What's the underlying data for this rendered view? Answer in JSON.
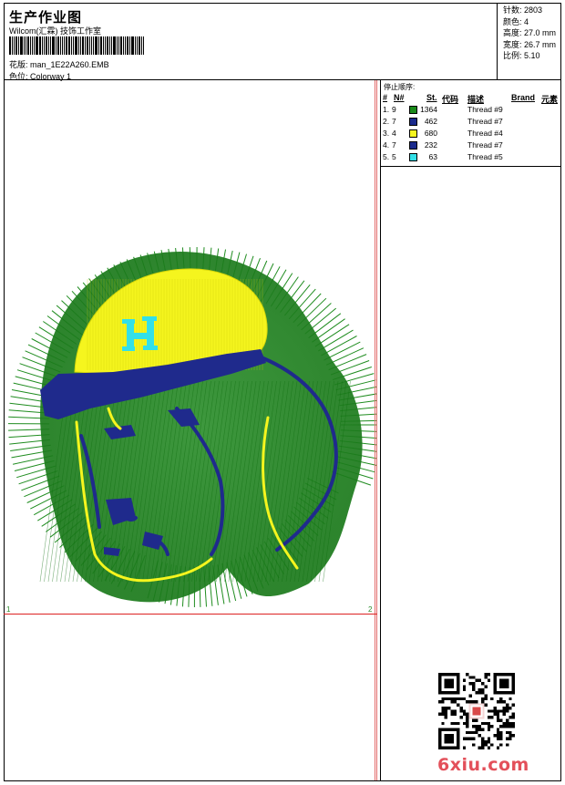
{
  "header": {
    "title": "生产作业图",
    "company": "Wilcom(汇霖) 技饰工作室",
    "design_label": "花版:",
    "design_file": "man_1E22A260.EMB",
    "colorway_label": "色位:",
    "colorway": "Colorway 1"
  },
  "specs": [
    {
      "label": "针数:",
      "value": "2803"
    },
    {
      "label": "颜色:",
      "value": "4"
    },
    {
      "label": "高度:",
      "value": "27.0 mm"
    },
    {
      "label": "宽度:",
      "value": "26.7 mm"
    },
    {
      "label": "比例:",
      "value": "5.10"
    }
  ],
  "stop_sequence": {
    "title": "停止顺序:",
    "headers": {
      "index": "#",
      "num": "N#",
      "stitches": "St.",
      "code": "代码",
      "desc": "描述",
      "brand": "Brand",
      "element": "元素"
    },
    "rows": [
      {
        "index": "1.",
        "num": "9",
        "color": "#1a8a1a",
        "stitches": "1364",
        "desc": "Thread #9"
      },
      {
        "index": "2.",
        "num": "7",
        "color": "#1a2a8c",
        "stitches": "462",
        "desc": "Thread #7"
      },
      {
        "index": "3.",
        "num": "4",
        "color": "#f5f51e",
        "stitches": "680",
        "desc": "Thread #4"
      },
      {
        "index": "4.",
        "num": "7",
        "color": "#1a2a8c",
        "stitches": "232",
        "desc": "Thread #7"
      },
      {
        "index": "5.",
        "num": "5",
        "color": "#33e0e8",
        "stitches": "63",
        "desc": "Thread #5"
      }
    ]
  },
  "canvas": {
    "marker_left": "1",
    "marker_right": "2"
  },
  "watermark": "6xiu.com",
  "colors": {
    "green": "#1f8c1f",
    "navy": "#1f2a8c",
    "yellow": "#f5f51e",
    "cyan": "#33e0e8",
    "guide_red": "#d22222"
  }
}
